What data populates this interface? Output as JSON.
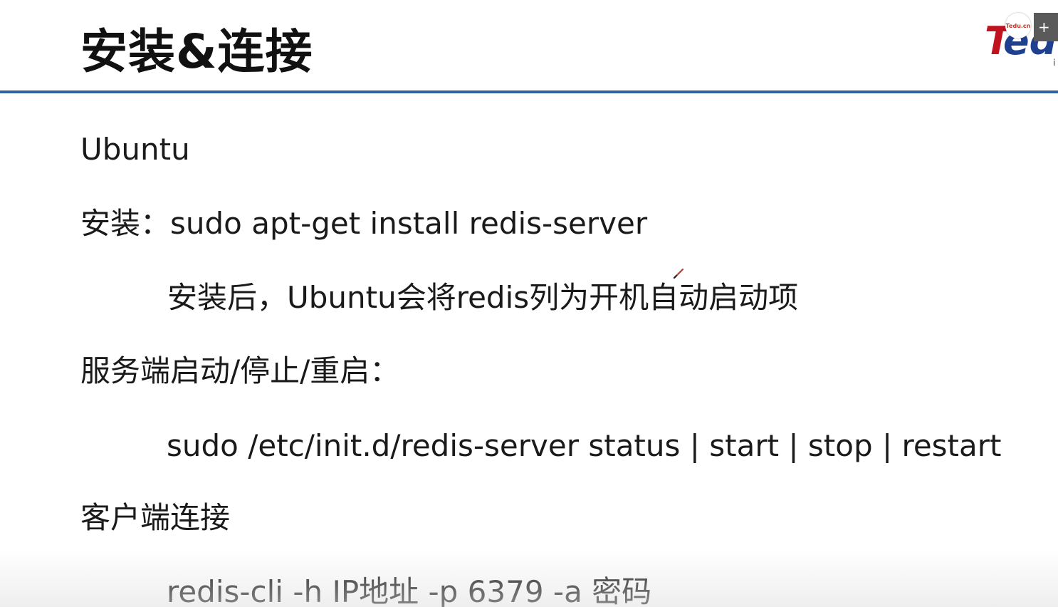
{
  "slide": {
    "title": "安装&连接",
    "lines": [
      "Ubuntu",
      "安装：sudo apt-get install redis-server",
      "安装后，Ubuntu会将redis列为开机自动启动项",
      "服务端启动/停止/重启：",
      "sudo /etc/init.d/redis-server status | start | stop | restart",
      "客户端连接",
      "redis-cli -h IP地址 -p 6379 -a 密码"
    ]
  },
  "logo": {
    "name": "tedu-logo",
    "badge_text": "Tedu.cn",
    "corner_glyph": "+",
    "brand_color": "#c0121f"
  },
  "colors": {
    "title_rule": "#2d63a5",
    "text": "#1a1a1a"
  },
  "icons": {
    "cursor": "pen-cursor-icon"
  }
}
